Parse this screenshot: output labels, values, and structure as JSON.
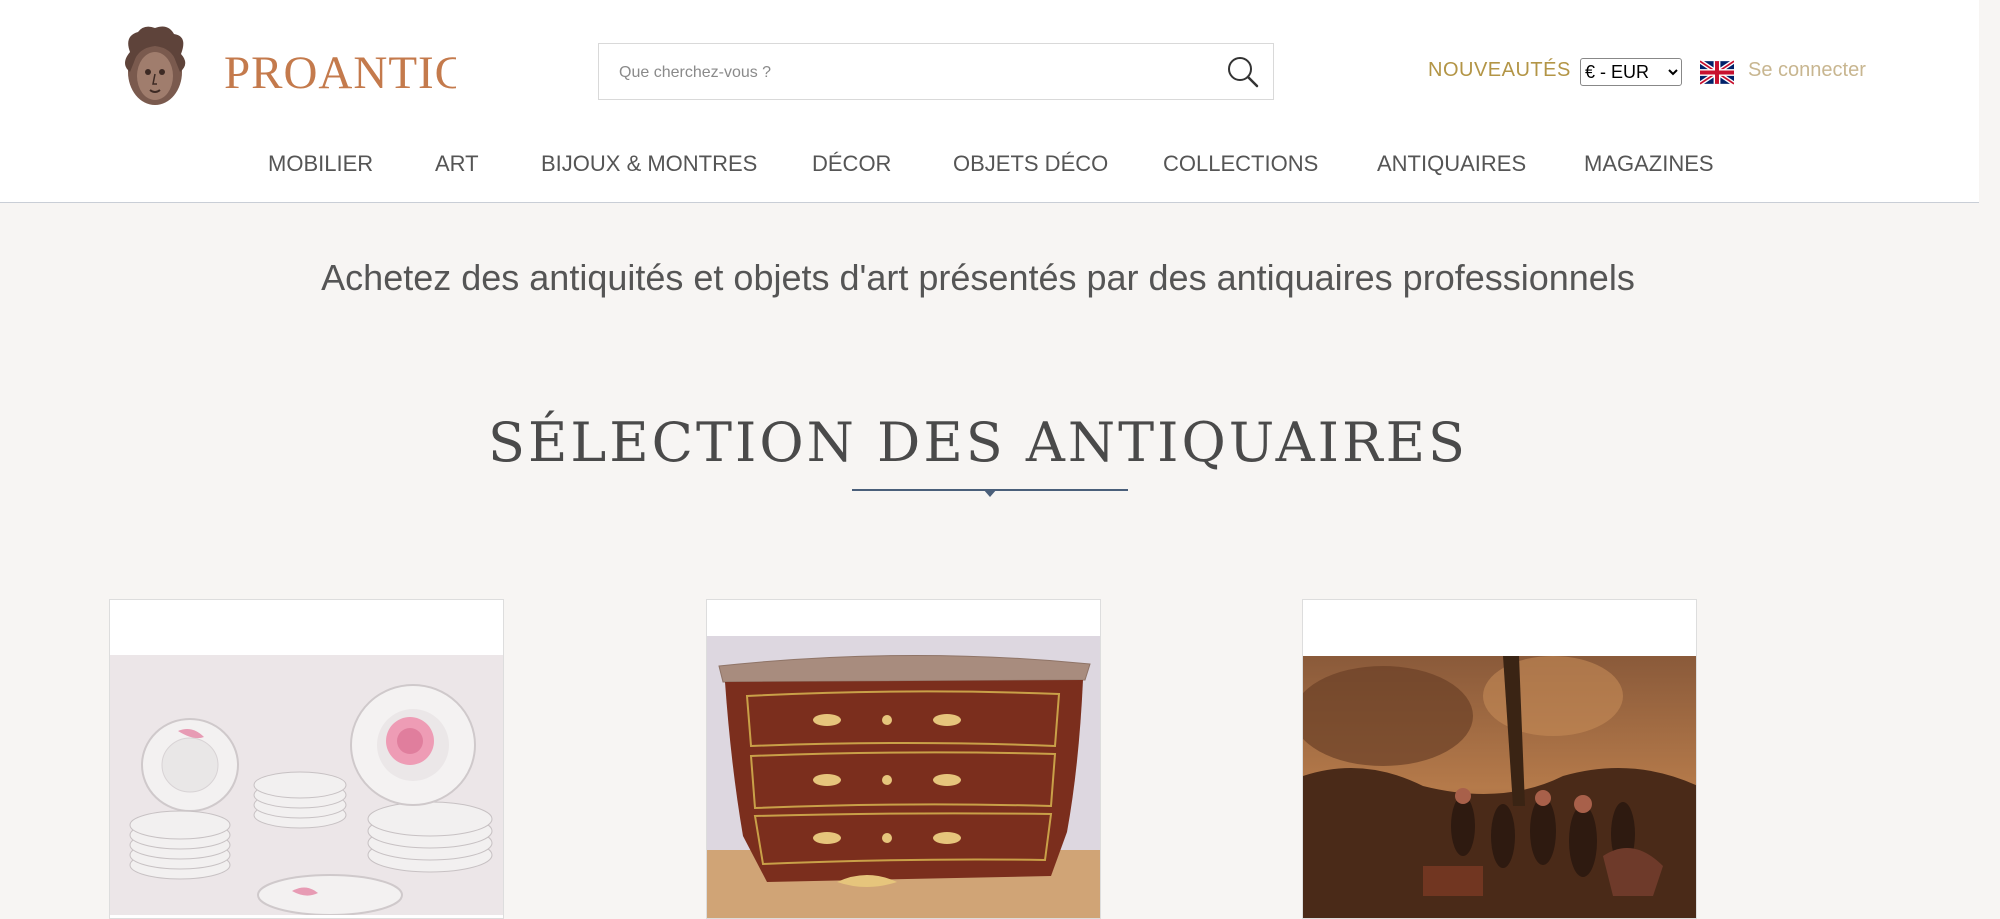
{
  "header": {
    "logo_text": "PROANTIC",
    "search": {
      "placeholder": "Que cherchez-vous ?",
      "value": ""
    },
    "nouveautes_label": "NOUVEAUTÉS",
    "currency": {
      "selected": "€ - EUR",
      "options": [
        "€ - EUR"
      ]
    },
    "language_flag": "uk-flag-icon",
    "login_label": "Se connecter"
  },
  "nav": {
    "items": [
      {
        "label": "MOBILIER"
      },
      {
        "label": "ART"
      },
      {
        "label": "BIJOUX & MONTRES"
      },
      {
        "label": "DÉCOR"
      },
      {
        "label": "OBJETS DÉCO"
      },
      {
        "label": "COLLECTIONS"
      },
      {
        "label": "ANTIQUAIRES"
      },
      {
        "label": "MAGAZINES"
      }
    ]
  },
  "main": {
    "tagline": "Achetez des antiquités et objets d'art présentés par des antiquaires professionnels",
    "section_title": "SÉLECTION DES ANTIQUAIRES",
    "cards": [
      {
        "image": "porcelain-plates-image"
      },
      {
        "image": "marquetry-commode-image"
      },
      {
        "image": "baroque-painting-image"
      }
    ]
  },
  "colors": {
    "brand": "#c47a4c",
    "gold": "#b39546",
    "login": "#c8b690",
    "divider": "#4a5f7a",
    "page_bg": "#f7f5f3"
  }
}
